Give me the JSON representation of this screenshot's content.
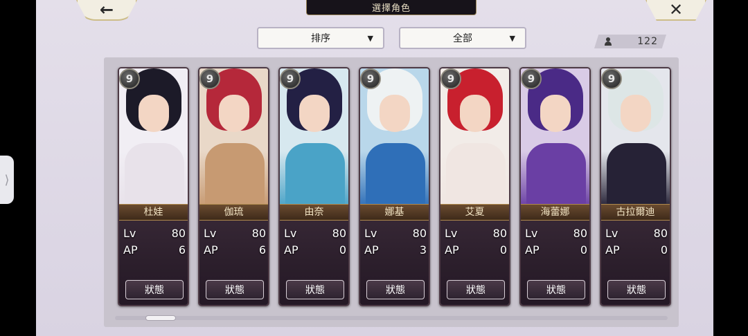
{
  "header": {
    "title": "選擇角色",
    "back_icon": "←",
    "close_icon": "✕"
  },
  "filters": {
    "sort_label": "排序",
    "filter_label": "全部",
    "chevron": "▼"
  },
  "roster_count": "122",
  "cards": [
    {
      "rank": "9",
      "name": "杜娃",
      "lv_label": "Lv",
      "lv": "80",
      "ap_label": "AP",
      "ap": "6",
      "status_label": "狀態",
      "hair": "#1c1a28",
      "outfit": "#e8e2ea",
      "bg": "#f1eef4"
    },
    {
      "rank": "9",
      "name": "伽琉",
      "lv_label": "Lv",
      "lv": "80",
      "ap_label": "AP",
      "ap": "6",
      "status_label": "狀態",
      "hair": "#b5283a",
      "outfit": "#c79a72",
      "bg": "#e9d8c8"
    },
    {
      "rank": "9",
      "name": "由奈",
      "lv_label": "Lv",
      "lv": "80",
      "ap_label": "AP",
      "ap": "0",
      "status_label": "狀態",
      "hair": "#232044",
      "outfit": "#4aa3c7",
      "bg": "#d7e8ef"
    },
    {
      "rank": "9",
      "name": "娜基",
      "lv_label": "Lv",
      "lv": "80",
      "ap_label": "AP",
      "ap": "3",
      "status_label": "狀態",
      "hair": "#eef2f3",
      "outfit": "#2f6fb8",
      "bg": "#b9d7ea"
    },
    {
      "rank": "9",
      "name": "艾夏",
      "lv_label": "Lv",
      "lv": "80",
      "ap_label": "AP",
      "ap": "0",
      "status_label": "狀態",
      "hair": "#c8202e",
      "outfit": "#f0e6e2",
      "bg": "#f2ece8"
    },
    {
      "rank": "9",
      "name": "海蕾娜",
      "lv_label": "Lv",
      "lv": "80",
      "ap_label": "AP",
      "ap": "0",
      "status_label": "狀態",
      "hair": "#4a2a86",
      "outfit": "#6a3fa4",
      "bg": "#d9cbe6"
    },
    {
      "rank": "9",
      "name": "古拉爾迪",
      "lv_label": "Lv",
      "lv": "80",
      "ap_label": "AP",
      "ap": "0",
      "status_label": "狀態",
      "hair": "#dde6e6",
      "outfit": "#262236",
      "bg": "#e4e6ec"
    }
  ]
}
